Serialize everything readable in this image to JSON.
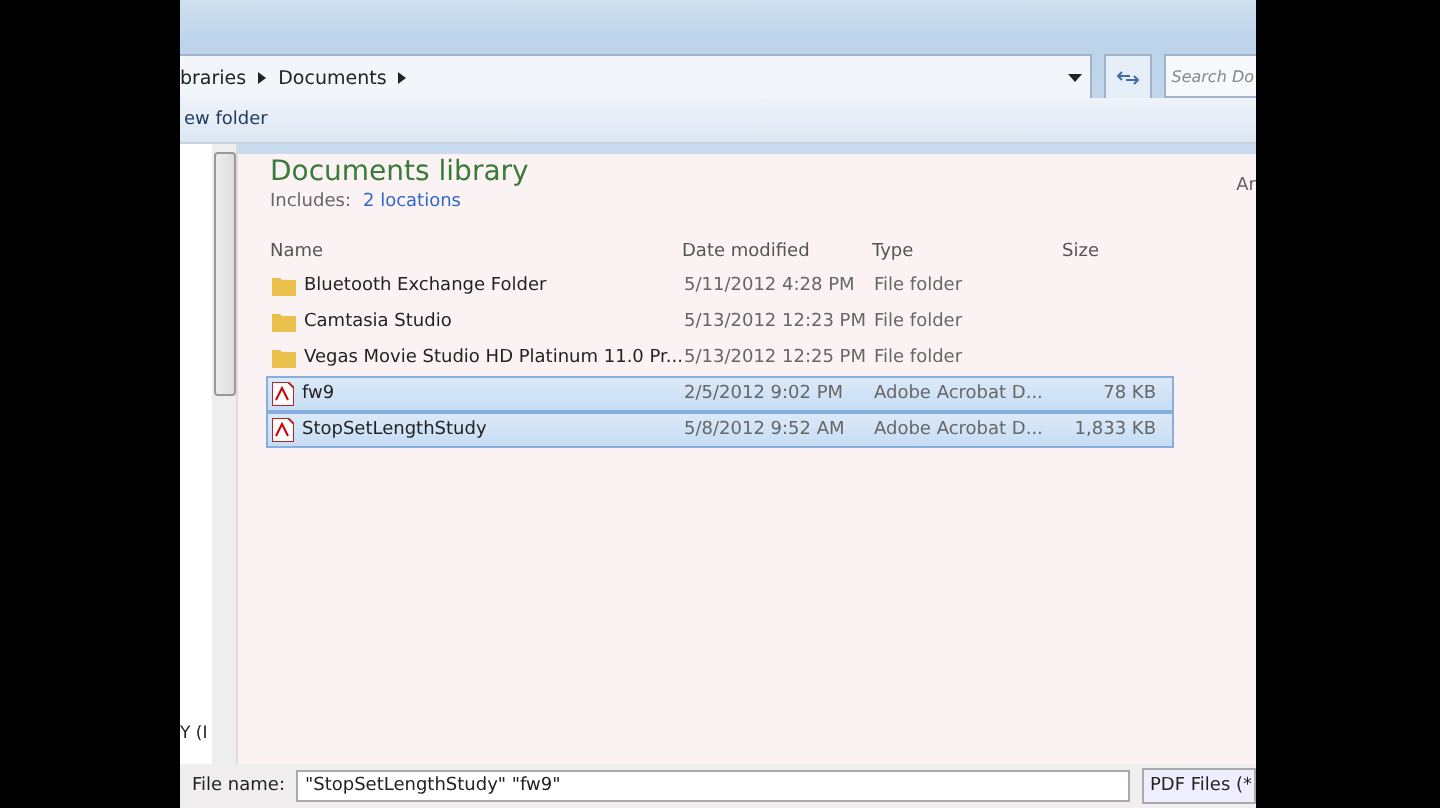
{
  "address_bar": {
    "crumbs": [
      "braries",
      "Documents"
    ],
    "search_placeholder": "Search Do"
  },
  "toolbar": {
    "button": "ew folder"
  },
  "library": {
    "title": "Documents library",
    "includes_label": "Includes:",
    "includes_link": "2 locations",
    "arrange": "Ar"
  },
  "table": {
    "columns": [
      "Name",
      "Date modified",
      "Type",
      "Size"
    ],
    "rows": [
      {
        "kind": "folder",
        "name": "Bluetooth Exchange Folder",
        "date": "5/11/2012 4:28 PM",
        "type": "File folder",
        "size": "",
        "selected": false
      },
      {
        "kind": "folder",
        "name": "Camtasia Studio",
        "date": "5/13/2012 12:23 PM",
        "type": "File folder",
        "size": "",
        "selected": false
      },
      {
        "kind": "folder",
        "name": "Vegas Movie Studio HD Platinum 11.0 Pr...",
        "date": "5/13/2012 12:25 PM",
        "type": "File folder",
        "size": "",
        "selected": false
      },
      {
        "kind": "pdf",
        "name": "fw9",
        "date": "2/5/2012 9:02 PM",
        "type": "Adobe Acrobat D...",
        "size": "78 KB",
        "selected": true
      },
      {
        "kind": "pdf",
        "name": "StopSetLengthStudy",
        "date": "5/8/2012 9:52 AM",
        "type": "Adobe Acrobat D...",
        "size": "1,833 KB",
        "selected": true
      }
    ]
  },
  "nav_pane": {
    "item": "Y (I"
  },
  "file_name": {
    "label": "File name:",
    "value": "\"StopSetLengthStudy\" \"fw9\"",
    "filter": "PDF Files (*"
  }
}
